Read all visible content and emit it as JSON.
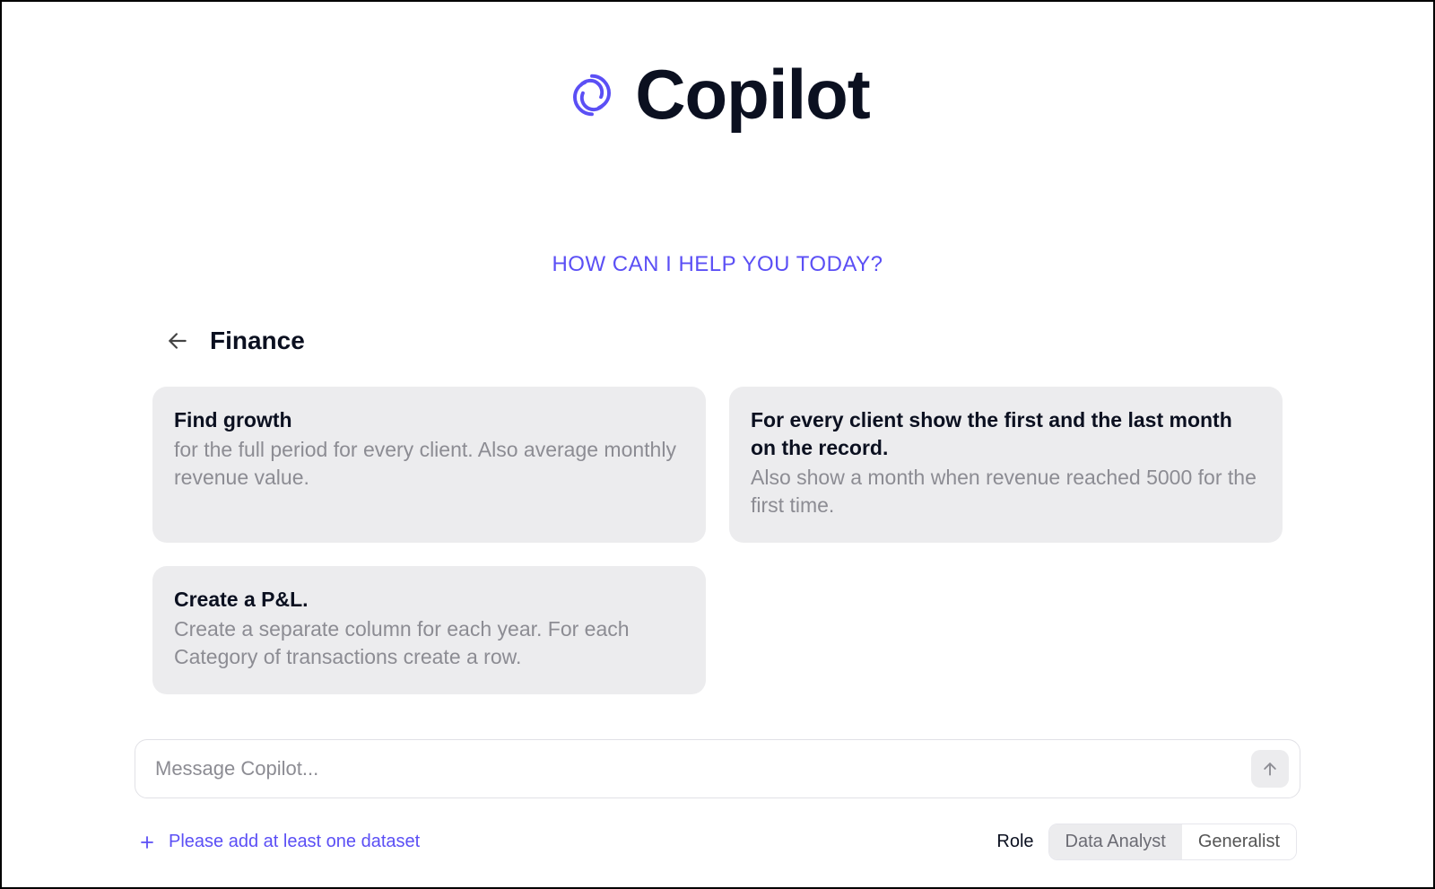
{
  "brand": {
    "title": "Copilot"
  },
  "tagline": "HOW CAN I HELP YOU TODAY?",
  "section": {
    "title": "Finance"
  },
  "cards": [
    {
      "title": "Find growth",
      "desc": "for the full period for every client. Also average monthly revenue value."
    },
    {
      "title": "For every client show the first and the last month on the record.",
      "desc": "Also show a month when revenue reached 5000 for the first time."
    },
    {
      "title": "Create a P&L.",
      "desc": "Create a separate column for each year. For each Category of transactions create a row."
    }
  ],
  "composer": {
    "placeholder": "Message Copilot..."
  },
  "dataset": {
    "hint": "Please add at least one dataset"
  },
  "role": {
    "label": "Role",
    "options": [
      "Data Analyst",
      "Generalist"
    ],
    "active": "Data Analyst"
  }
}
